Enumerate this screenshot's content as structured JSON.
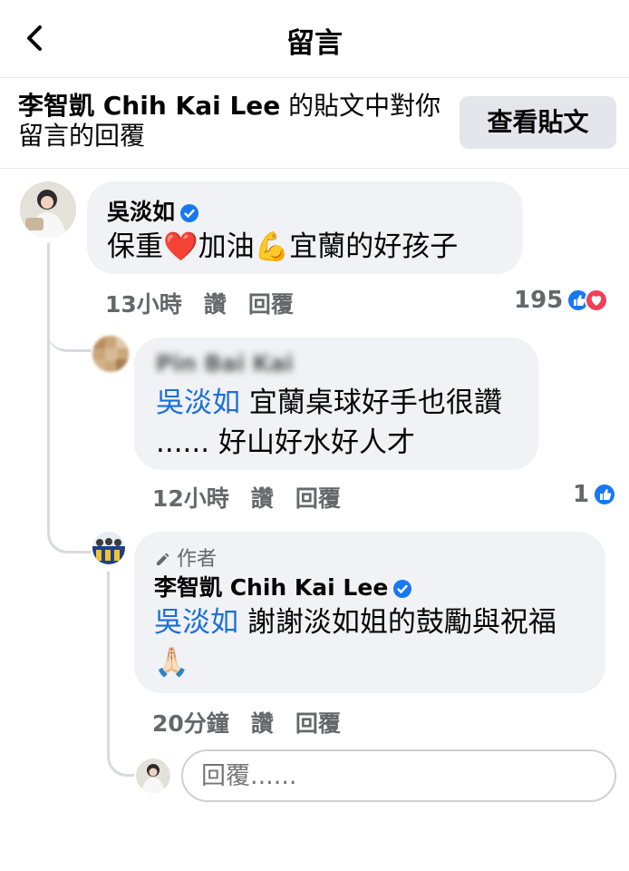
{
  "header": {
    "title": "留言"
  },
  "banner": {
    "author": "李智凱 Chih Kai Lee",
    "text_suffix": " 的貼文中對你留言的回覆",
    "view_post_label": "查看貼文"
  },
  "comments": [
    {
      "name": "吳淡如",
      "text_a": "保重",
      "heart": "❤️",
      "text_b": "加油",
      "muscle": "💪",
      "text_c": "宜蘭的好孩子",
      "time": "13小時",
      "like_label": "讚",
      "reply_label": "回覆",
      "reaction_count": "195"
    },
    {
      "name_blurred": "Pin Bai Kai",
      "mention": "吳淡如",
      "text": " 宜蘭桌球好手也很讚 ...... 好山好水好人才",
      "time": "12小時",
      "like_label": "讚",
      "reply_label": "回覆",
      "reaction_count": "1"
    },
    {
      "badge": "作者",
      "name": "李智凱 Chih Kai Lee",
      "mention": "吳淡如",
      "text": " 謝謝淡如姐的鼓勵與祝福",
      "emoji": "🙏🏻",
      "time": "20分鐘",
      "like_label": "讚",
      "reply_label": "回覆"
    }
  ],
  "reply_input": {
    "placeholder": "回覆......"
  },
  "colors": {
    "accent": "#1877f2",
    "mention": "#1b6fd8",
    "bubble": "#f0f2f5",
    "heart": "#f33e58"
  }
}
